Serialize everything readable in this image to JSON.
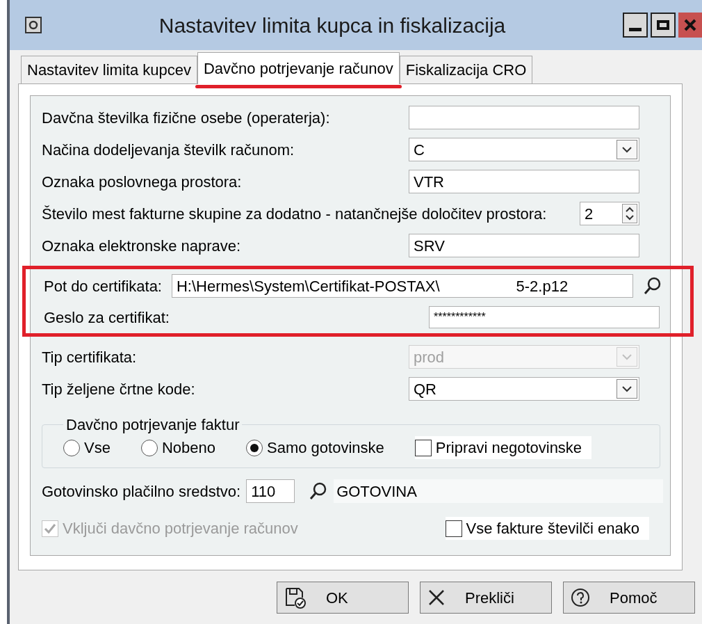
{
  "window": {
    "title": "Nastavitev limita kupca in fiskalizacija"
  },
  "tabs": [
    {
      "label": "Nastavitev limita kupcev",
      "selected": false
    },
    {
      "label": "Davčno potrjevanje računov",
      "selected": true
    },
    {
      "label": "Fiskalizacija CRO",
      "selected": false
    }
  ],
  "fields_top": [
    {
      "kind": "text",
      "label": "Davčna številka fizične osebe (operaterja):",
      "disabled": false
    },
    {
      "kind": "combo",
      "label": "Načina dodeljevanja številk računom:",
      "value": "C",
      "disabled": false
    },
    {
      "kind": "text",
      "label": "Oznaka poslovnega prostora:",
      "value": "VTR",
      "disabled": false
    },
    {
      "kind": "spin",
      "label": "Število mest fakturne skupine za dodatno - natančnejše določitev prostora:",
      "value": "2",
      "disabled": false
    },
    {
      "kind": "text",
      "label": "Oznaka elektronske naprave:",
      "value": "SRV",
      "disabled": false
    }
  ],
  "certificate": {
    "highlighted": true,
    "path_label": "Pot do certifikata:",
    "path_value": "H:\\Hermes\\System\\Certifikat-POSTAX\\",
    "path_value_end": "5-2.p12",
    "password_label": "Geslo za certifikat:",
    "password_value": "************"
  },
  "fields_bottom": [
    {
      "kind": "combo",
      "label": "Tip certifikata:",
      "value": "prod",
      "disabled": true
    },
    {
      "kind": "combo",
      "label": "Tip željene črtne kode:",
      "value": "QR",
      "disabled": false
    }
  ],
  "group": {
    "title": "Davčno potrjevanje faktur",
    "options": [
      {
        "label": "Vse",
        "selected": false
      },
      {
        "label": "Nobeno",
        "selected": false
      },
      {
        "label": "Samo gotovinske",
        "selected": true
      }
    ],
    "checkbox": {
      "label": "Pripravi negotovinske",
      "checked": false
    }
  },
  "payment": {
    "label": "Gotovinsko plačilno sredstvo:",
    "code": "110",
    "name": "GOTOVINA"
  },
  "include": {
    "label": "Vključi davčno potrjevanje računov",
    "checked": true,
    "disabled": true
  },
  "same_numbering": {
    "label": "Vse fakture številči enako",
    "checked": false
  },
  "buttons": [
    {
      "kind": "save",
      "label": "OK"
    },
    {
      "kind": "cancel",
      "label": "Prekliči"
    },
    {
      "kind": "help",
      "label": "Pomoč"
    }
  ]
}
